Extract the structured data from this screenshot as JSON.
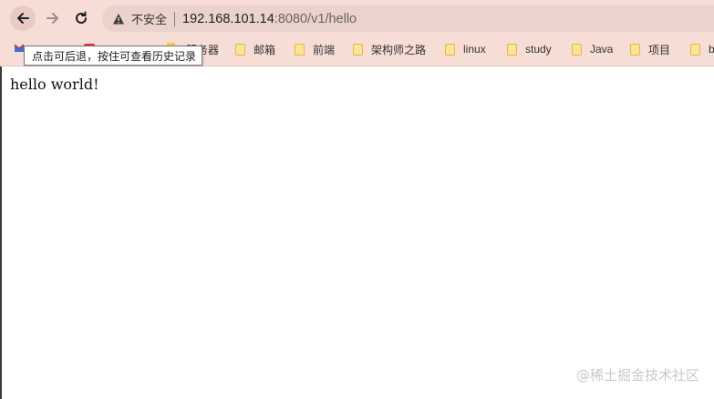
{
  "toolbar": {
    "back_tooltip": "点击可后退，按住可查看历史记录"
  },
  "omnibox": {
    "security_label": "不安全",
    "url_host": "192.168.101.14",
    "url_path": ":8080/v1/hello"
  },
  "bookmarks": {
    "items": [
      {
        "label": "服务器"
      },
      {
        "label": "邮箱"
      },
      {
        "label": "前端"
      },
      {
        "label": "架构师之路"
      },
      {
        "label": "linux"
      },
      {
        "label": "study"
      },
      {
        "label": "Java"
      },
      {
        "label": "项目"
      },
      {
        "label": "b"
      }
    ]
  },
  "page": {
    "body_text": "hello world!"
  },
  "watermark": {
    "text": "@稀土掘金技术社区"
  },
  "colors": {
    "chrome_bg": "#f6ddd6",
    "omnibox_bg": "#ead3cd",
    "folder_yellow": "#f4c542"
  }
}
